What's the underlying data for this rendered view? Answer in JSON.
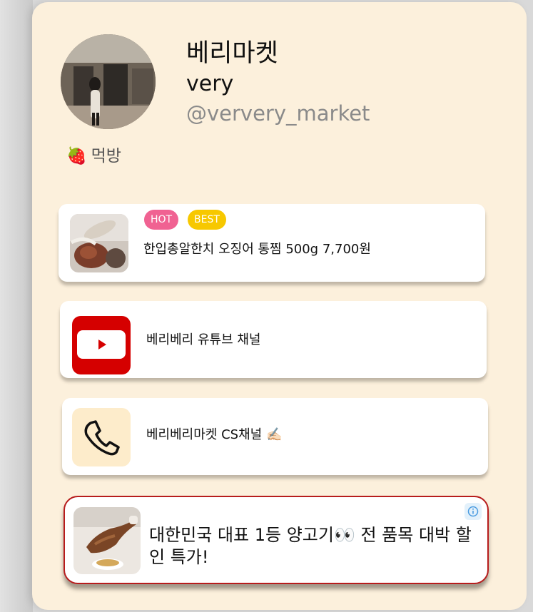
{
  "profile": {
    "name": "베리마켓",
    "subname": "very",
    "handle": "@ververy_market",
    "category_emoji": "🍓",
    "category_label": "먹방"
  },
  "links": [
    {
      "title": "한입총알한치 오징어 통찜 500g 7,700원",
      "badges": [
        "HOT",
        "BEST"
      ],
      "icon": "product-thumbnail"
    },
    {
      "title": "베리베리 유튜브 채널",
      "icon": "youtube-icon"
    },
    {
      "title": "베리베리마켓 CS채널",
      "trailing_emoji": "✍🏻",
      "icon": "phone-icon"
    }
  ],
  "ad": {
    "text": "대한민국 대표 1등 양고기👀 전 품목 대박 할인 특가!",
    "icon": "info-icon"
  },
  "colors": {
    "background": "#fcf0dc",
    "hot_badge": "#f06292",
    "best_badge": "#f7c800",
    "youtube_red": "#d50000",
    "ad_border": "#b71c1c"
  }
}
